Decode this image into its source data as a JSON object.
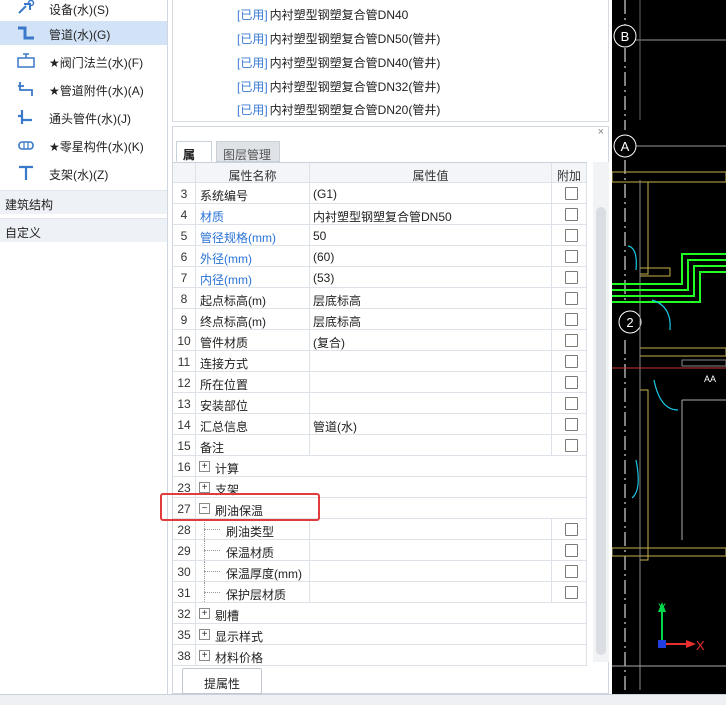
{
  "left_tree": {
    "items": [
      {
        "label": "设备(水)(S)",
        "icon": "equipment-icon",
        "selected": false
      },
      {
        "label": "管道(水)(G)",
        "icon": "pipe-icon",
        "selected": true
      },
      {
        "label": "★阀门法兰(水)(F)",
        "icon": "valve-flange-icon",
        "selected": false
      },
      {
        "label": "★管道附件(水)(A)",
        "icon": "pipe-accessory-icon",
        "selected": false
      },
      {
        "label": "通头管件(水)(J)",
        "icon": "pipe-fitting-icon",
        "selected": false
      },
      {
        "label": "★零星构件(水)(K)",
        "icon": "misc-component-icon",
        "selected": false
      },
      {
        "label": "支架(水)(Z)",
        "icon": "bracket-icon",
        "selected": false
      }
    ],
    "categories": [
      "建筑结构",
      "自定义"
    ]
  },
  "top_list": [
    {
      "tag": "[已用]",
      "name": "内衬塑型钢塑复合管DN40"
    },
    {
      "tag": "[已用]",
      "name": "内衬塑型钢塑复合管DN50(管井)"
    },
    {
      "tag": "[已用]",
      "name": "内衬塑型钢塑复合管DN40(管井)"
    },
    {
      "tag": "[已用]",
      "name": "内衬塑型钢塑复合管DN32(管井)"
    },
    {
      "tag": "[已用]",
      "name": "内衬塑型钢塑复合管DN20(管井)"
    }
  ],
  "prop_panel": {
    "close": "×",
    "tabs": [
      "属性",
      "图层管理"
    ],
    "headers": {
      "name": "属性名称",
      "value": "属性值",
      "add": "附加"
    },
    "rows": [
      {
        "num": "3",
        "name": "系统编号",
        "value": "(G1)",
        "blue": false,
        "check": true
      },
      {
        "num": "4",
        "name": "材质",
        "value": "内衬塑型钢塑复合管DN50",
        "blue": true,
        "check": true
      },
      {
        "num": "5",
        "name": "管径规格(mm)",
        "value": "50",
        "blue": true,
        "check": true
      },
      {
        "num": "6",
        "name": "外径(mm)",
        "value": "(60)",
        "blue": true,
        "check": true
      },
      {
        "num": "7",
        "name": "内径(mm)",
        "value": "(53)",
        "blue": true,
        "check": true
      },
      {
        "num": "8",
        "name": "起点标高(m)",
        "value": "层底标高",
        "blue": false,
        "check": true
      },
      {
        "num": "9",
        "name": "终点标高(m)",
        "value": "层底标高",
        "blue": false,
        "check": true
      },
      {
        "num": "10",
        "name": "管件材质",
        "value": "(复合)",
        "blue": false,
        "check": true
      },
      {
        "num": "11",
        "name": "连接方式",
        "value": "",
        "blue": false,
        "check": true
      },
      {
        "num": "12",
        "name": "所在位置",
        "value": "",
        "blue": false,
        "check": true
      },
      {
        "num": "13",
        "name": "安装部位",
        "value": "",
        "blue": false,
        "check": true
      },
      {
        "num": "14",
        "name": "汇总信息",
        "value": "管道(水)",
        "blue": false,
        "check": true
      },
      {
        "num": "15",
        "name": "备注",
        "value": "",
        "blue": false,
        "check": true
      },
      {
        "num": "16",
        "name": "计算",
        "group": "+"
      },
      {
        "num": "23",
        "name": "支架",
        "group": "+"
      },
      {
        "num": "27",
        "name": "刷油保温",
        "group": "−"
      },
      {
        "num": "28",
        "name": "刷油类型",
        "child": true,
        "check": true
      },
      {
        "num": "29",
        "name": "保温材质",
        "child": true,
        "check": true
      },
      {
        "num": "30",
        "name": "保温厚度(mm)",
        "child": true,
        "check": true
      },
      {
        "num": "31",
        "name": "保护层材质",
        "child": true,
        "check": true
      },
      {
        "num": "32",
        "name": "剔槽",
        "group": "+"
      },
      {
        "num": "35",
        "name": "显示样式",
        "group": "+"
      },
      {
        "num": "38",
        "name": "材料价格",
        "group": "+"
      }
    ],
    "extract_button": "提属性"
  },
  "cad": {
    "axis_labels": [
      "B",
      "A",
      "2"
    ],
    "annotation": "AA",
    "ucs_y": "Y",
    "ucs_x": "X",
    "colors": {
      "background": "#000000",
      "pipe": "#22ff22",
      "wall": "#c9b24a",
      "axis": "#ffffff",
      "door": "#19c8e6",
      "ucs": "#00d84a"
    }
  }
}
